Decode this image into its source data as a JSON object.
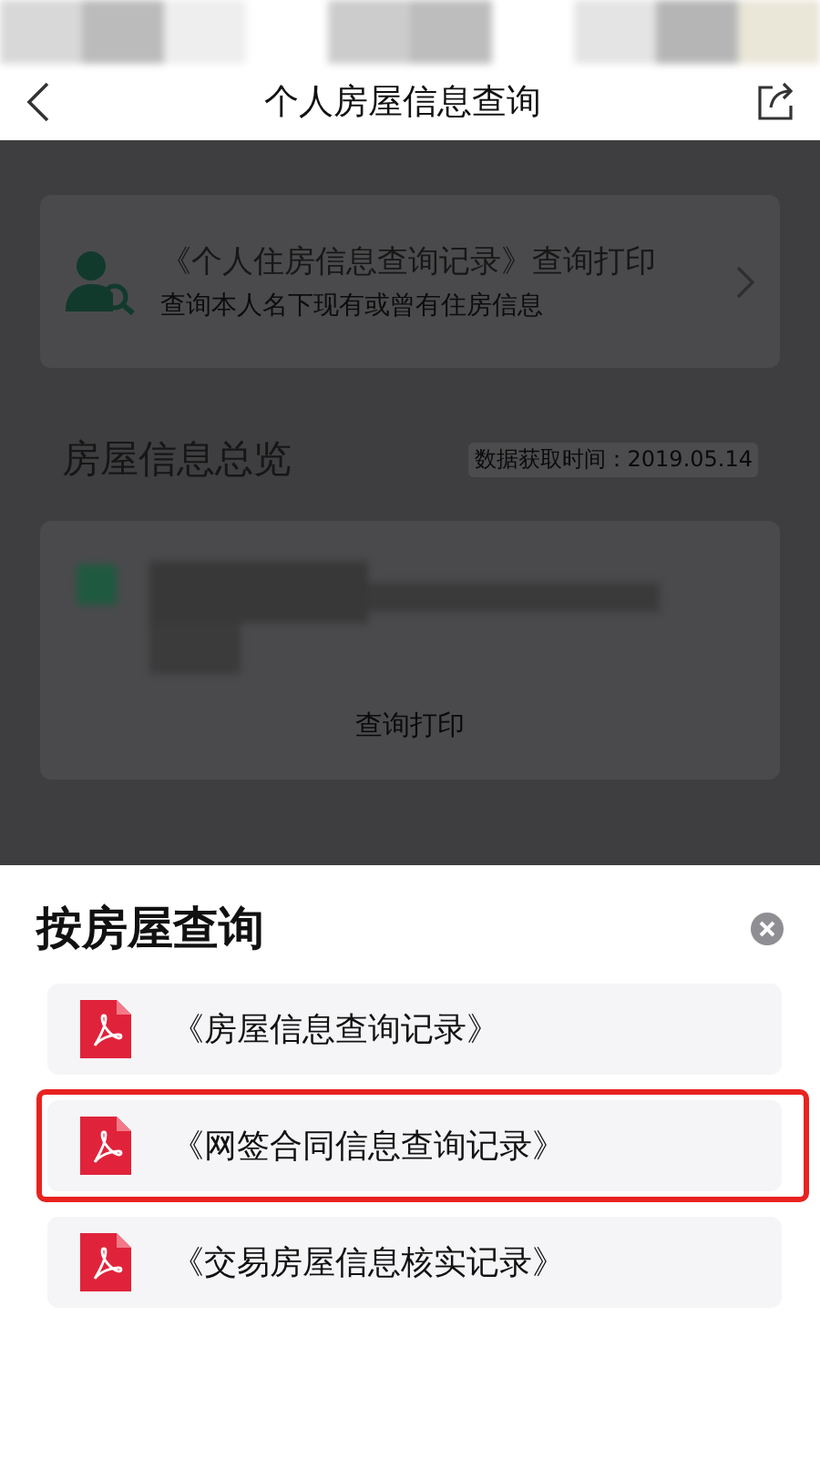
{
  "nav": {
    "title": "个人房屋信息查询"
  },
  "background": {
    "record_card": {
      "title": "《个人住房信息查询记录》查询打印",
      "subtitle": "查询本人名下现有或曾有住房信息"
    },
    "overview": {
      "title": "房屋信息总览",
      "timestamp": "数据获取时间：2019.05.14",
      "print_label": "查询打印"
    }
  },
  "sheet": {
    "title": "按房屋查询",
    "items": [
      {
        "label": "《房屋信息查询记录》",
        "highlighted": false
      },
      {
        "label": "《网签合同信息查询记录》",
        "highlighted": true
      },
      {
        "label": "《交易房屋信息核实记录》",
        "highlighted": false
      }
    ]
  }
}
